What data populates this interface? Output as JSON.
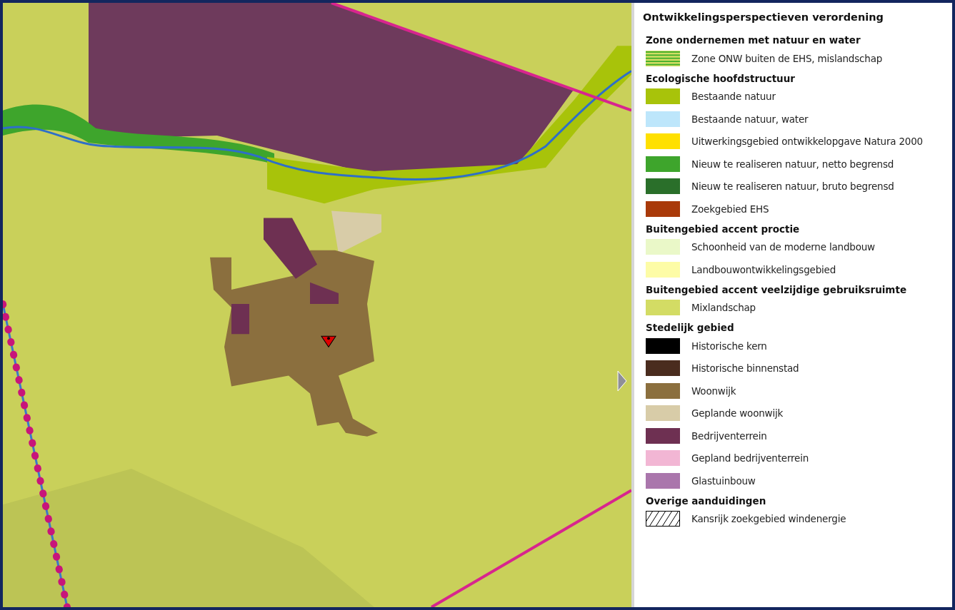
{
  "legend": {
    "title": "Ontwikkelingsperspectieven verordening",
    "groups": [
      {
        "heading": "Zone ondernemen met natuur en water",
        "items": [
          {
            "label": "Zone ONW buiten de EHS, mislandschap",
            "kind": "stripes",
            "color": "#3fae2a"
          }
        ]
      },
      {
        "heading": "Ecologische hoofdstructuur",
        "items": [
          {
            "label": "Bestaande natuur",
            "kind": "solid",
            "color": "#a8c30a"
          },
          {
            "label": "Bestaande natuur, water",
            "kind": "solid",
            "color": "#bde6fb"
          },
          {
            "label": "Uitwerkingsgebied ontwikkelopgave Natura 2000",
            "kind": "solid",
            "color": "#ffe000"
          },
          {
            "label": "Nieuw te realiseren natuur, netto begrensd",
            "kind": "solid",
            "color": "#3ea52c"
          },
          {
            "label": "Nieuw te realiseren natuur, bruto begrensd",
            "kind": "solid",
            "color": "#2a6f2a"
          },
          {
            "label": "Zoekgebied EHS",
            "kind": "solid",
            "color": "#a93a0a"
          }
        ]
      },
      {
        "heading": "Buitengebied accent proctie",
        "items": [
          {
            "label": "Schoonheid van de moderne landbouw",
            "kind": "solid",
            "color": "#eaf8c8"
          },
          {
            "label": "Landbouwontwikkelingsgebied",
            "kind": "solid",
            "color": "#fdfca6"
          }
        ]
      },
      {
        "heading": "Buitengebied accent veelzijdige gebruiksruimte",
        "items": [
          {
            "label": "Mixlandschap",
            "kind": "solid",
            "color": "#d3dc64"
          }
        ]
      },
      {
        "heading": "Stedelijk gebied",
        "items": [
          {
            "label": "Historische kern",
            "kind": "solid",
            "color": "#000000"
          },
          {
            "label": "Historische binnenstad",
            "kind": "solid",
            "color": "#4a2c1e"
          },
          {
            "label": "Woonwijk",
            "kind": "solid",
            "color": "#8b6f3e"
          },
          {
            "label": "Geplande woonwijk",
            "kind": "solid",
            "color": "#d8cca8"
          },
          {
            "label": "Bedrijventerrein",
            "kind": "solid",
            "color": "#6e3052"
          },
          {
            "label": "Gepland bedrijventerrein",
            "kind": "solid",
            "color": "#f2b6d4"
          },
          {
            "label": "Glastuinbouw",
            "kind": "solid",
            "color": "#aa76ac"
          }
        ]
      },
      {
        "heading": "Overige aanduidingen",
        "items": [
          {
            "label": "Kansrijk zoekgebied windenergie",
            "kind": "hatch",
            "color": "#000000"
          }
        ]
      }
    ]
  }
}
